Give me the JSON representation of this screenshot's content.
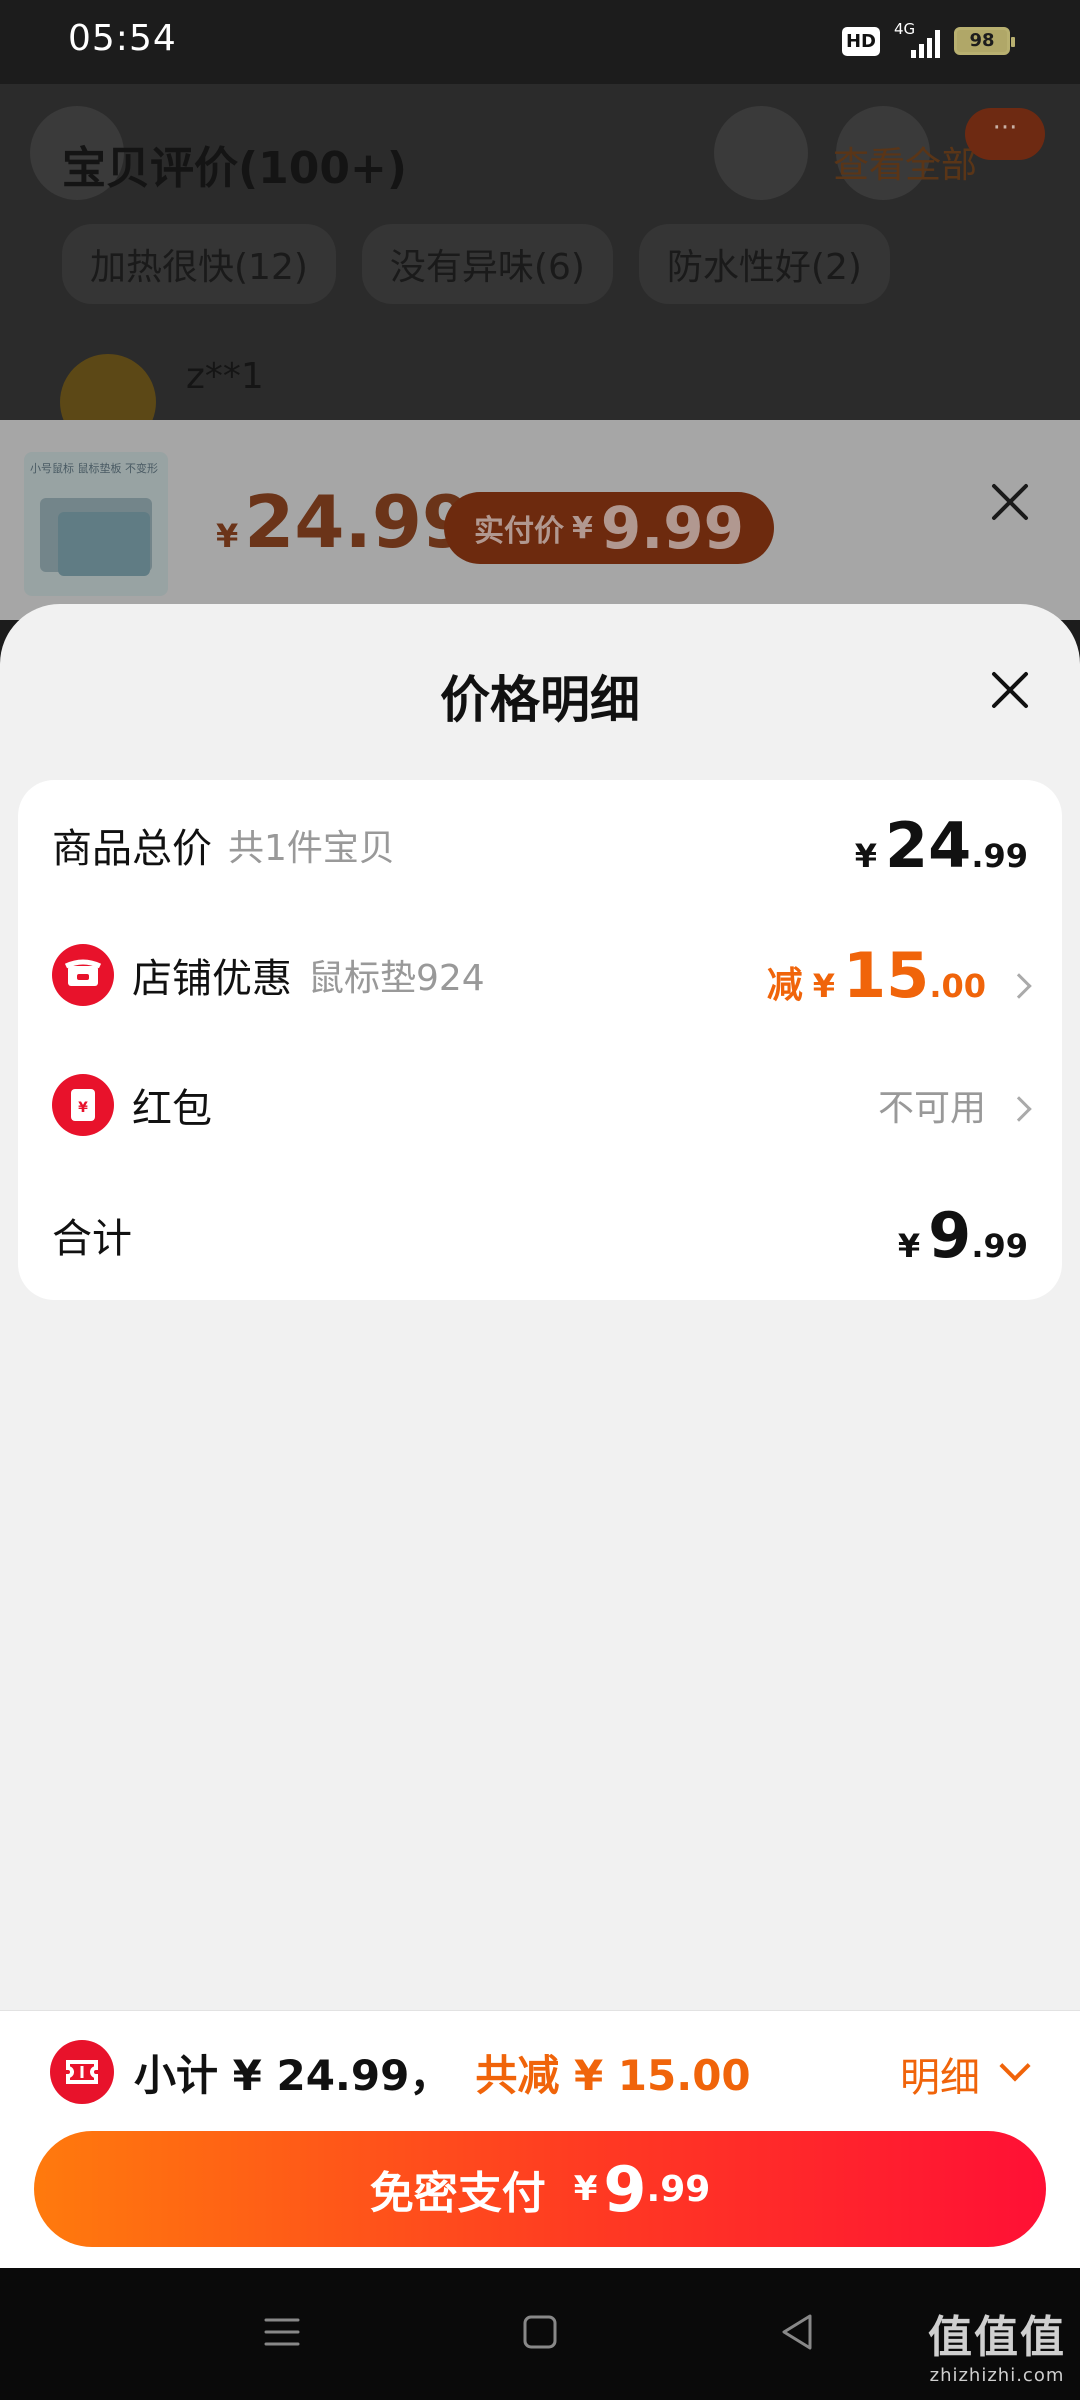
{
  "status_bar": {
    "time": "05:54",
    "hd": "HD",
    "network": "4G",
    "battery": "98"
  },
  "background_page": {
    "title": "宝贝评价(100+)",
    "view_all": "查看全部",
    "dot_label": "···",
    "tags": [
      "加热很快(12)",
      "没有异味(6)",
      "防水性好(2)"
    ],
    "reviewer": "z**1"
  },
  "product_strip": {
    "thumb_caption": "小号鼠标 鼠标垫板 不变形",
    "price_symbol": "¥",
    "price": "24.99",
    "paid_label": "实付价",
    "paid_symbol": "¥",
    "paid_price": "9.99"
  },
  "sheet": {
    "title": "价格明细",
    "rows": {
      "total": {
        "label": "商品总价",
        "sub": "共1件宝贝",
        "symbol": "¥",
        "int": "24",
        "dec": ".99"
      },
      "shop": {
        "label": "店铺优惠",
        "sub": "鼠标垫924",
        "prefix": "减",
        "symbol": "¥",
        "int": "15",
        "dec": ".00"
      },
      "redpack": {
        "label": "红包",
        "value": "不可用"
      },
      "sum": {
        "label": "合计",
        "symbol": "¥",
        "int": "9",
        "dec": ".99"
      }
    }
  },
  "bottom_bar": {
    "subtotal": "小计 ¥ 24.99，",
    "discount": "共减 ¥ 15.00",
    "detail_label": "明细",
    "pay_label": "免密支付",
    "pay_symbol": "¥",
    "pay_int": "9",
    "pay_dec": ".99"
  },
  "watermark": {
    "main": "值值值",
    "sub": "zhizhizhi.com"
  },
  "colors": {
    "accent_orange": "#f0640a",
    "brand_red": "#e8122b",
    "pay_gradient_start": "#ff7a0d",
    "pay_gradient_end": "#ff1035"
  }
}
